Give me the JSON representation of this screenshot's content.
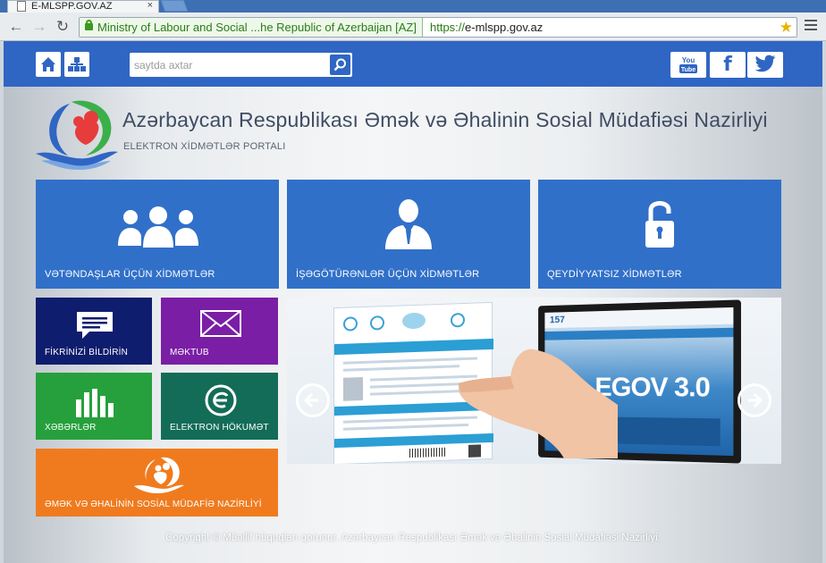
{
  "browser": {
    "tab_title": "E-MLSPP.GOV.AZ",
    "ev_label": "Ministry of Labour and Social ...he Republic of Azerbaijan [AZ]",
    "url_scheme": "https://",
    "url_host": "e-mlspp.gov.az"
  },
  "topbar": {
    "search_placeholder": "saytda axtar",
    "social": [
      "YouTube",
      "f",
      "twitter"
    ]
  },
  "header": {
    "title": "Azərbaycan Respublikası Əmək və Əhalinin Sosial Müdafiəsi Nazirliyi",
    "subtitle": "ELEKTRON XİDMƏTLƏR PORTALI"
  },
  "tiles": {
    "citizens": "VƏTƏNDAŞLAR ÜÇÜN XİDMƏTLƏR",
    "employers": "İŞƏGÖTÜRƏNLƏR ÜÇÜN XİDMƏTLƏR",
    "unregistered": "QEYDİYYATSIZ XİDMƏTLƏR",
    "feedback": "FİKRİNİZİ BİLDİRİN",
    "letter": "MƏKTUB",
    "news": "XƏBƏRLƏR",
    "egov": "ELEKTRON HÖKUMƏT",
    "ministry": "ƏMƏK VƏ ƏHALİNİN SOSİAL MÜDAFİƏ NAZİRLİYİ"
  },
  "slider": {
    "badge": "EGOV 3.0",
    "hotline": "157"
  },
  "footer": {
    "text": "Copyright © Müəllif hüquqları qorunur. Azərbaycan Respublikası Əmək və Əhalinin Sosial Müdafiəsi Nazirliyi."
  },
  "colors": {
    "brand_blue": "#2f66c4",
    "tile_blue": "#3170c9",
    "navy": "#0f1d6e",
    "purple": "#7a1ea6",
    "green": "#26a03c",
    "teal": "#136c57",
    "orange": "#f07b1e"
  }
}
